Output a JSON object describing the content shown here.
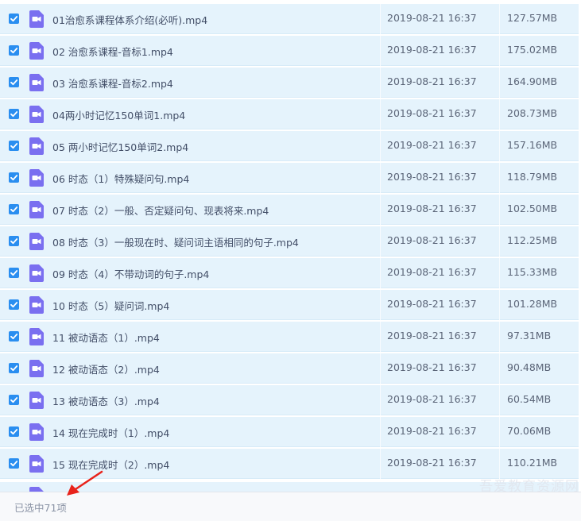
{
  "files": [
    {
      "name": "01治愈系课程体系介绍(必听).mp4",
      "date": "2019-08-21 16:37",
      "size": "127.57MB"
    },
    {
      "name": "02 治愈系课程-音标1.mp4",
      "date": "2019-08-21 16:37",
      "size": "175.02MB"
    },
    {
      "name": "03 治愈系课程-音标2.mp4",
      "date": "2019-08-21 16:37",
      "size": "164.90MB"
    },
    {
      "name": "04两小时记忆150单词1.mp4",
      "date": "2019-08-21 16:37",
      "size": "208.73MB"
    },
    {
      "name": "05 两小时记忆150单词2.mp4",
      "date": "2019-08-21 16:37",
      "size": "157.16MB"
    },
    {
      "name": "06 时态（1）特殊疑问句.mp4",
      "date": "2019-08-21 16:37",
      "size": "118.79MB"
    },
    {
      "name": "07 时态（2）一般、否定疑问句、现表将来.mp4",
      "date": "2019-08-21 16:37",
      "size": "102.50MB"
    },
    {
      "name": "08 时态（3）一般现在时、疑问词主语相同的句子.mp4",
      "date": "2019-08-21 16:37",
      "size": "112.25MB"
    },
    {
      "name": "09 时态（4）不带动词的句子.mp4",
      "date": "2019-08-21 16:37",
      "size": "115.33MB"
    },
    {
      "name": "10 时态（5）疑问词.mp4",
      "date": "2019-08-21 16:37",
      "size": "101.28MB"
    },
    {
      "name": "11 被动语态（1）.mp4",
      "date": "2019-08-21 16:37",
      "size": "97.31MB"
    },
    {
      "name": "12 被动语态（2）.mp4",
      "date": "2019-08-21 16:37",
      "size": "90.48MB"
    },
    {
      "name": "13 被动语态（3）.mp4",
      "date": "2019-08-21 16:37",
      "size": "60.54MB"
    },
    {
      "name": "14 现在完成时（1）.mp4",
      "date": "2019-08-21 16:37",
      "size": "70.06MB"
    },
    {
      "name": "15 现在完成时（2）.mp4",
      "date": "2019-08-21 16:37",
      "size": "110.21MB"
    }
  ],
  "status": {
    "selected_text": "已选中71项"
  },
  "watermark": "吾爱教育资源网",
  "icons": {
    "checkbox": "checkbox-checked-icon",
    "file": "video-file-icon",
    "annotation": "red-arrow-icon"
  },
  "colors": {
    "row_bg": "#e5f3fc",
    "checkbox": "#2a8ef0",
    "video_icon": "#7a6ff0",
    "arrow": "#e8231b"
  }
}
